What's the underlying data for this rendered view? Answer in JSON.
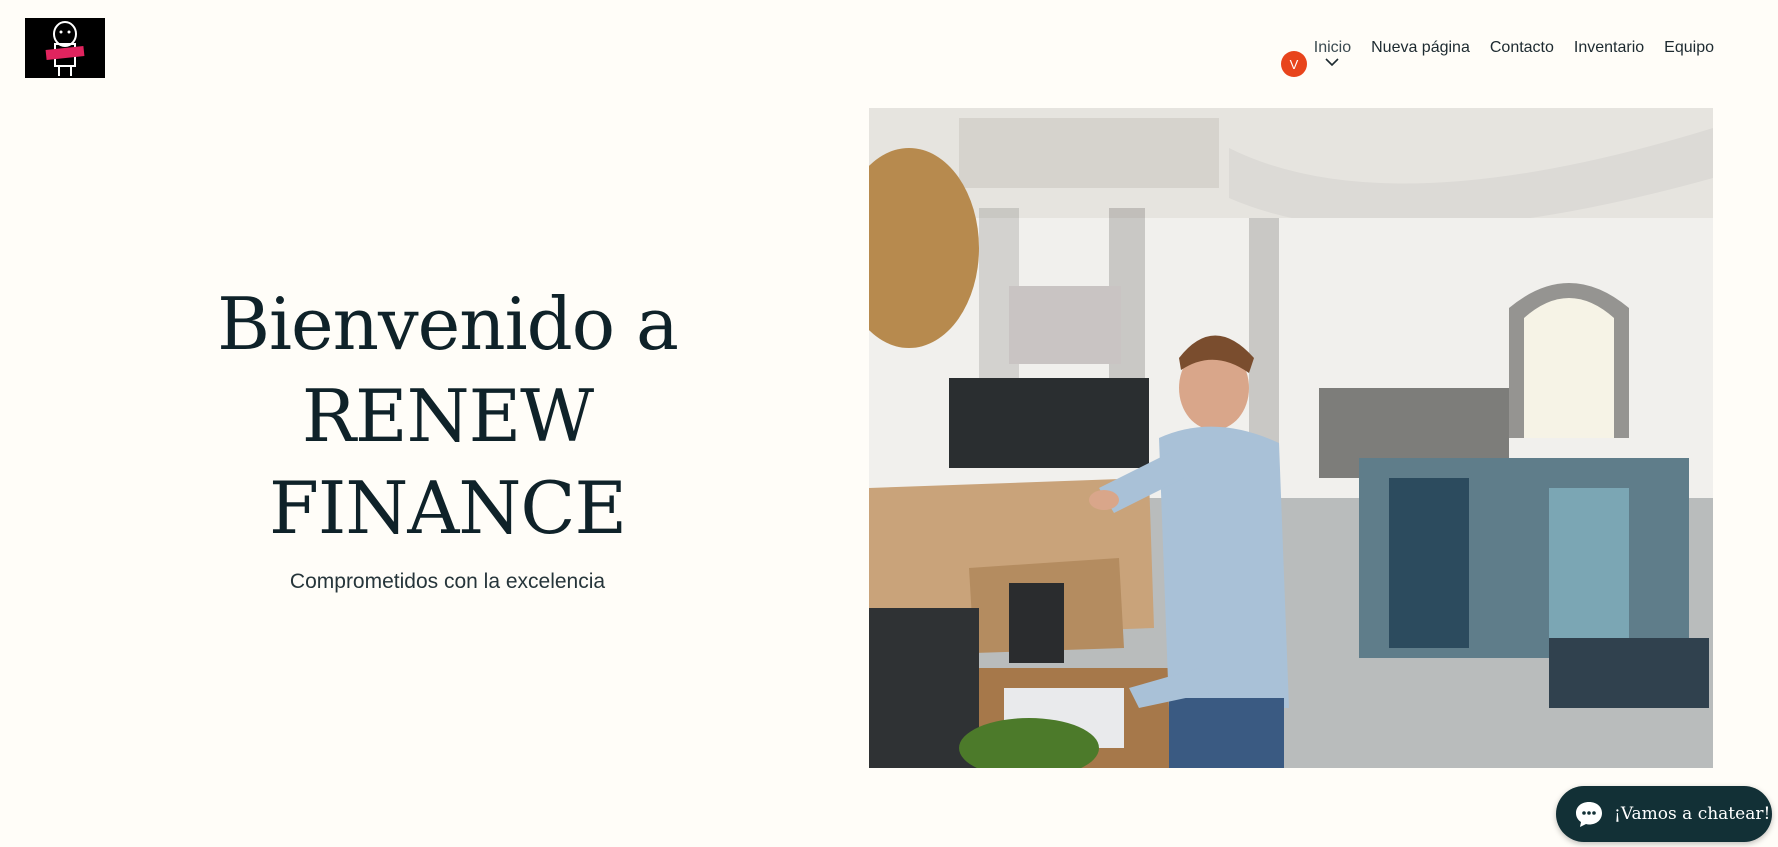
{
  "header": {
    "logo_alt": "RENEW FINANCE logo",
    "avatar_initial": "V",
    "nav": [
      {
        "label": "Inicio",
        "active": true
      },
      {
        "label": "Nueva página"
      },
      {
        "label": "Contacto"
      },
      {
        "label": "Inventario"
      },
      {
        "label": "Equipo"
      }
    ]
  },
  "hero": {
    "title_lines": [
      "Bienvenido a",
      "RENEW",
      "FINANCE"
    ],
    "subtitle": "Comprometidos con la excelencia"
  },
  "chat": {
    "label": "¡Vamos a chatear!"
  },
  "colors": {
    "background": "#fffdf8",
    "accent": "#e8441c",
    "chat_bg": "#123036"
  }
}
